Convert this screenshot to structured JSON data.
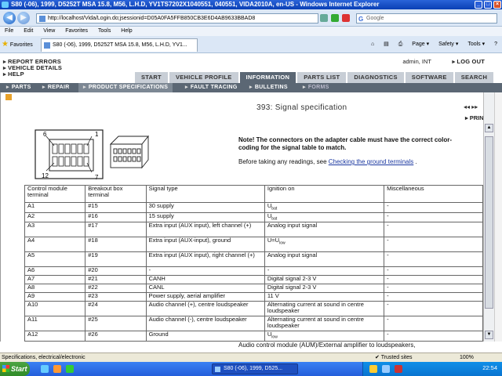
{
  "window": {
    "title": "S80 (-06), 1999, D5252T MSA 15.8, M56, L.H.D, YV1TS7202X1040551, 040551, VIDA2010A, en-US - Windows Internet Explorer"
  },
  "browser": {
    "url": "http://localhost/Vida/Login.do;jsessionid=D05A0FA5FFB850CB3E6D4AB9633BBAD8",
    "search_placeholder": "Google",
    "menu": [
      "File",
      "Edit",
      "View",
      "Favorites",
      "Tools",
      "Help"
    ],
    "favorites_label": "Favorites",
    "tab_title": "S80 (-06), 1999, D5252T MSA 15.8, M56, L.H.D, YV1...",
    "tools": [
      "Page ▾",
      "Safety ▾",
      "Tools ▾"
    ]
  },
  "app": {
    "left_links": [
      "REPORT ERRORS",
      "VEHICLE DETAILS",
      "HELP"
    ],
    "user": "admin, INT",
    "logout": "LOG OUT",
    "tabs": [
      "START",
      "VEHICLE PROFILE",
      "INFORMATION",
      "PARTS LIST",
      "DIAGNOSTICS",
      "SOFTWARE",
      "SEARCH"
    ],
    "active_tab": "INFORMATION",
    "subnav": [
      "PARTS",
      "REPAIR",
      "PRODUCT SPECIFICATIONS",
      "FAULT TRACING",
      "BULLETINS",
      "FORMS"
    ]
  },
  "content": {
    "title": "393: Signal specification",
    "print_label": "PRINT",
    "note": "Note! The connectors on the adapter cable must have the correct color-coding for the signal table to match.",
    "before_text": "Before taking any readings, see",
    "before_link": "Checking the ground terminals",
    "before_end": ".",
    "connector_labels": [
      "6",
      "1",
      "12",
      "7"
    ],
    "table": {
      "headers": [
        "Control module terminal",
        "Breakout box terminal",
        "Signal type",
        "Ignition on",
        "Miscellaneous"
      ],
      "rows": [
        [
          "A1",
          "#15",
          "30 supply",
          "Ubat",
          "-"
        ],
        [
          "A2",
          "#16",
          "15 supply",
          "Ubat",
          "-"
        ],
        [
          "A3",
          "#17",
          "Extra input (AUX input), left channel (+)",
          "Analog input signal",
          "-"
        ],
        [
          "A4",
          "#18",
          "Extra input (AUX-input), ground",
          "U=Ulow",
          "-"
        ],
        [
          "A5",
          "#19",
          "Extra input (AUX input), right channel (+)",
          "Analog input signal",
          "-"
        ],
        [
          "A6",
          "#20",
          "-",
          "-",
          "-"
        ],
        [
          "A7",
          "#21",
          "CANH",
          "Digital signal 2-3 V",
          "-"
        ],
        [
          "A8",
          "#22",
          "CANL",
          "Digital signal 2-3 V",
          "-"
        ],
        [
          "A9",
          "#23",
          "Power supply, aerial amplifier",
          "11 V",
          "-"
        ],
        [
          "A10",
          "#24",
          "Audio channel (+), centre loudspeaker",
          "Alternating current at sound in centre loudspeaker",
          "-"
        ],
        [
          "A11",
          "#25",
          "Audio channel (-), centre loudspeaker",
          "Alternating current at sound in centre loudspeaker",
          "-"
        ],
        [
          "A12",
          "#26",
          "Ground",
          "Ulow",
          "-"
        ]
      ]
    },
    "footer_text": "Audio control module (AUM)/External amplifier to loudspeakers,"
  },
  "status": {
    "left": "Specifications, electrical/electronic",
    "trusted": "Trusted sites",
    "zoom": "100%"
  },
  "taskbar": {
    "start": "Start",
    "item": "S80 (-06), 1999, D525...",
    "clock": "22:54"
  }
}
